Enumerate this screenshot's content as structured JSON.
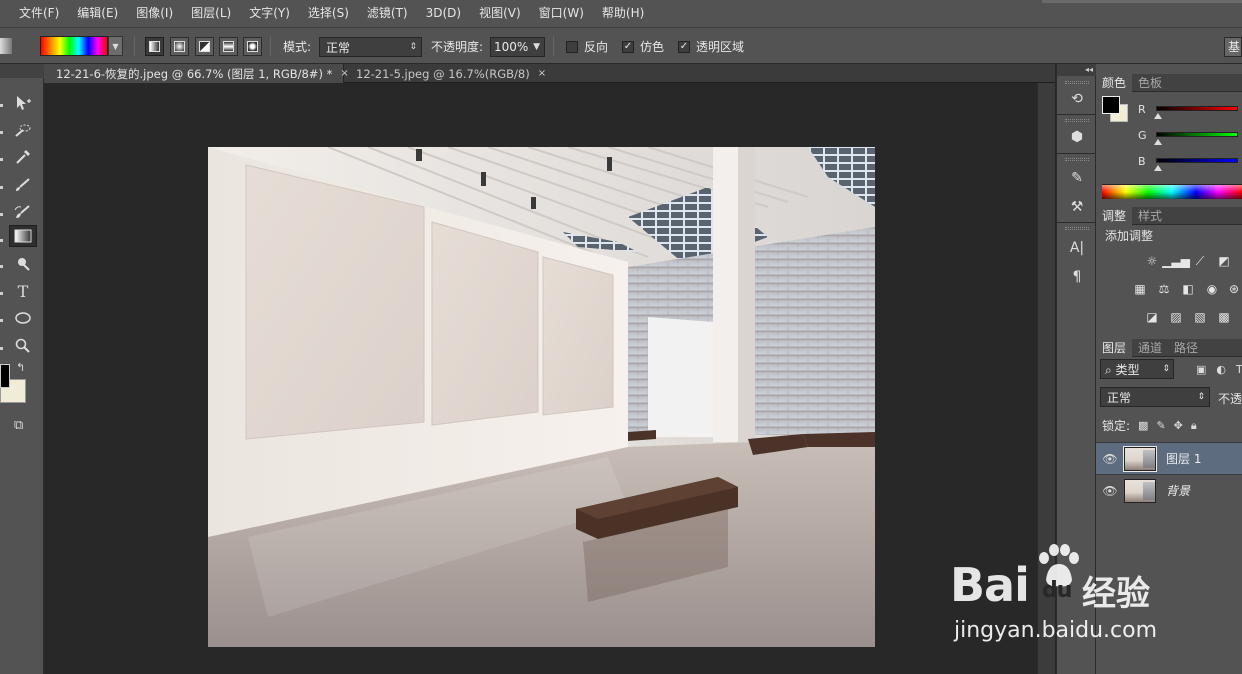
{
  "menubar": {
    "items": [
      "文件(F)",
      "编辑(E)",
      "图像(I)",
      "图层(L)",
      "文字(Y)",
      "选择(S)",
      "滤镜(T)",
      "3D(D)",
      "视图(V)",
      "窗口(W)",
      "帮助(H)"
    ]
  },
  "options": {
    "mode_label": "模式:",
    "mode_value": "正常",
    "opacity_label": "不透明度:",
    "opacity_value": "100%",
    "reverse_label": "反向",
    "dither_label": "仿色",
    "transparency_label": "透明区域",
    "reverse_checked": false,
    "dither_checked": true,
    "transparency_checked": true,
    "workspace_label": "基"
  },
  "tabs": [
    {
      "title": "12-21-6-恢复的.jpeg @ 66.7% (图层 1, RGB/8#) *",
      "close": "×"
    },
    {
      "title": "12-21-5.jpeg @ 16.7%(RGB/8)",
      "close": "×"
    }
  ],
  "toolbar": {
    "tools": [
      "move-tool-icon",
      "quick-select-icon",
      "eyedropper-icon",
      "brush-icon",
      "history-brush-icon",
      "gradient-icon",
      "dodge-icon",
      "type-icon",
      "ellipse-icon",
      "zoom-icon"
    ],
    "active_tool": "gradient-icon",
    "foreground_color": "#000000",
    "background_color": "#f0ecd8"
  },
  "color_panel": {
    "tabs": [
      "颜色",
      "色板"
    ],
    "channels": [
      "R",
      "G",
      "B"
    ],
    "channel_colors": [
      "#ff0000",
      "#00ff00",
      "#0000ff"
    ]
  },
  "adjustments_panel": {
    "tabs": [
      "调整",
      "样式"
    ],
    "title": "添加调整"
  },
  "layers_panel": {
    "tabs": [
      "图层",
      "通道",
      "路径"
    ],
    "filter_value": "类型",
    "blend_mode": "正常",
    "opacity_label": "不透",
    "lock_label": "锁定:",
    "layers": [
      {
        "name": "图层 1",
        "selected": true,
        "visible": true
      },
      {
        "name": "背景",
        "selected": false,
        "visible": true
      }
    ]
  },
  "watermark": {
    "logo_left": "Bai",
    "logo_right": "du",
    "product": "经验",
    "url": "jingyan.baidu.com"
  },
  "colors": {
    "ui_bg": "#535353",
    "canvas_bg": "#282828",
    "selection": "#5d6c7e"
  }
}
